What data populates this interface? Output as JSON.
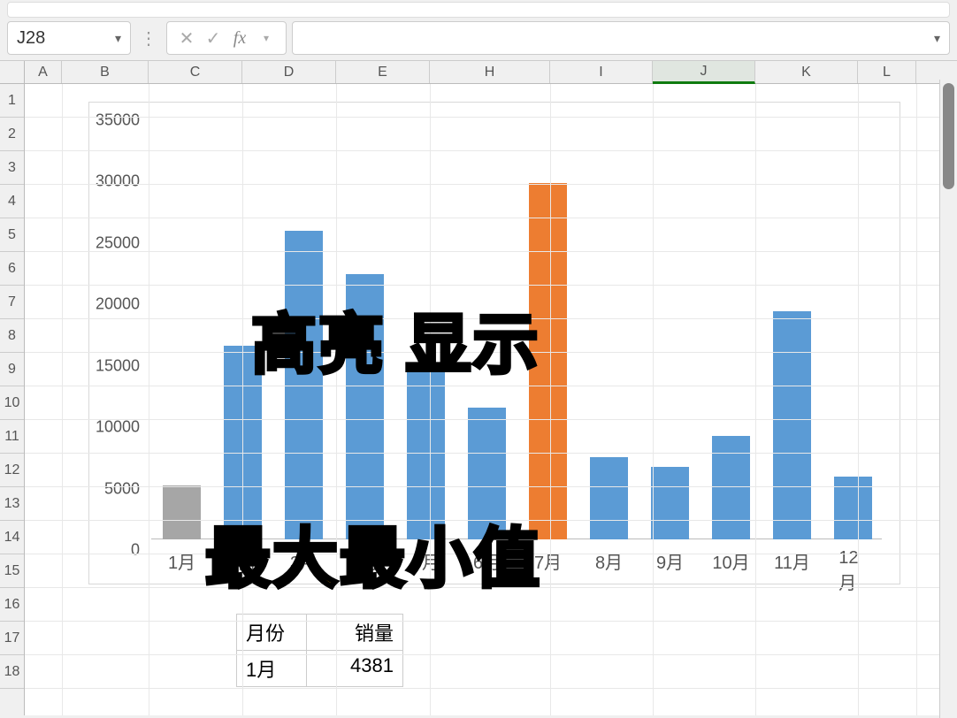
{
  "name_box": {
    "value": "J28"
  },
  "formula_bar": {
    "value": ""
  },
  "fx_label": "fx",
  "columns": [
    "A",
    "B",
    "C",
    "D",
    "E",
    "H",
    "I",
    "J",
    "K",
    "L"
  ],
  "active_column": "J",
  "row_count": 18,
  "chart_data": {
    "type": "bar",
    "categories": [
      "1月",
      "2月",
      "3月",
      "4月",
      "5月",
      "6月",
      "7月",
      "8月",
      "9月",
      "10月",
      "11月",
      "12月"
    ],
    "values": [
      4381,
      15800,
      25100,
      21600,
      14100,
      10700,
      29000,
      6700,
      5900,
      8400,
      18600,
      5100
    ],
    "highlight_max_index": 6,
    "highlight_min_index": 0,
    "ylim": [
      0,
      35000
    ],
    "yticks": [
      0,
      5000,
      10000,
      15000,
      20000,
      25000,
      30000,
      35000
    ],
    "xlabel": "",
    "ylabel": "",
    "title": ""
  },
  "table": {
    "headers": [
      "月份",
      "销量"
    ],
    "rows": [
      [
        "1月",
        "4381"
      ]
    ]
  },
  "overlay": {
    "line1": "高亮 显示",
    "line2": "最大最小值"
  }
}
